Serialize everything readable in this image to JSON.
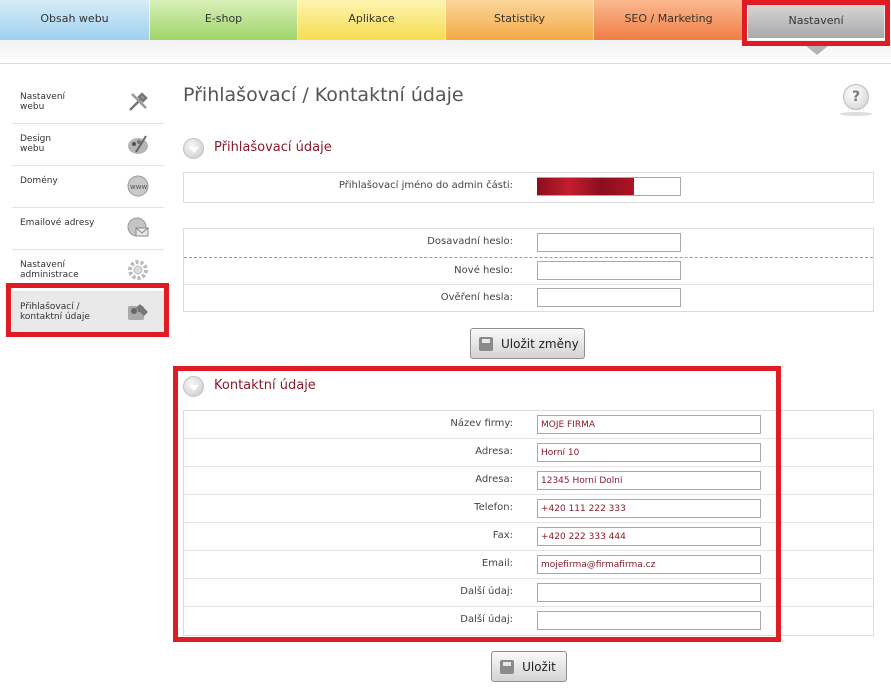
{
  "tabs": [
    {
      "label": "Obsah webu"
    },
    {
      "label": "E-shop"
    },
    {
      "label": "Aplikace"
    },
    {
      "label": "Statistiky"
    },
    {
      "label": "SEO / Marketing"
    },
    {
      "label": "Nastavení",
      "active": true
    }
  ],
  "sidebar": {
    "items": [
      {
        "label": "Nastavení\nwebu",
        "icon": "tools-icon"
      },
      {
        "label": "Design\nwebu",
        "icon": "palette-icon"
      },
      {
        "label": "Domény",
        "icon": "globe-www-icon"
      },
      {
        "label": "Emailové adresy",
        "icon": "email-globe-icon"
      },
      {
        "label": "Nastavení\nadministrace",
        "icon": "gear-icon"
      },
      {
        "label": "Přihlašovací /\nkontaktní údaje",
        "icon": "user-card-icon",
        "active": true
      }
    ]
  },
  "page": {
    "title": "Přihlašovací / Kontaktní údaje",
    "help_label": "?"
  },
  "login": {
    "section_title": "Přihlašovací údaje",
    "username_label": "Přihlašovací jméno do admin části:",
    "current_password_label": "Dosavadní heslo:",
    "new_password_label": "Nové heslo:",
    "confirm_password_label": "Ověření hesla:",
    "save_label": "Uložit změny"
  },
  "contact": {
    "section_title": "Kontaktní údaje",
    "fields": [
      {
        "label": "Název firmy:",
        "value": "MOJE FIRMA"
      },
      {
        "label": "Adresa:",
        "value": "Horní 10"
      },
      {
        "label": "Adresa:",
        "value": "12345 Horní Dolní"
      },
      {
        "label": "Telefon:",
        "value": "+420 111 222 333"
      },
      {
        "label": "Fax:",
        "value": "+420 222 333 444"
      },
      {
        "label": "Email:",
        "value": "mojefirma@firmafirma.cz"
      },
      {
        "label": "Další údaj:",
        "value": ""
      },
      {
        "label": "Další údaj:",
        "value": ""
      }
    ],
    "save_label": "Uložit"
  },
  "colors": {
    "highlight": "#e01b24",
    "section_title": "#8a1a2e"
  }
}
